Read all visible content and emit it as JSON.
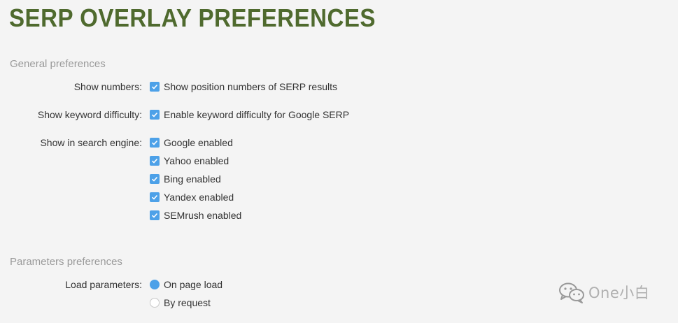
{
  "page": {
    "title": "SERP OVERLAY PREFERENCES"
  },
  "general": {
    "heading": "General preferences",
    "show_numbers": {
      "label": "Show numbers:",
      "option": "Show position numbers of SERP results",
      "checked": true
    },
    "show_keyword_difficulty": {
      "label": "Show keyword difficulty:",
      "option": "Enable keyword difficulty for Google SERP",
      "checked": true
    },
    "search_engines": {
      "label": "Show in search engine:",
      "options": [
        {
          "label": "Google enabled",
          "checked": true
        },
        {
          "label": "Yahoo enabled",
          "checked": true
        },
        {
          "label": "Bing enabled",
          "checked": true
        },
        {
          "label": "Yandex enabled",
          "checked": true
        },
        {
          "label": "SEMrush enabled",
          "checked": true
        }
      ]
    }
  },
  "parameters": {
    "heading": "Parameters preferences",
    "load_parameters": {
      "label": "Load parameters:",
      "options": [
        {
          "label": "On page load",
          "selected": true
        },
        {
          "label": "By request",
          "selected": false
        }
      ]
    }
  },
  "watermark": {
    "text": "One小白",
    "icon": "wechat-icon"
  },
  "colors": {
    "title": "#4f6a2e",
    "heading": "#9a9a9a",
    "accent": "#4da1e8",
    "background": "#f4f4f4"
  }
}
